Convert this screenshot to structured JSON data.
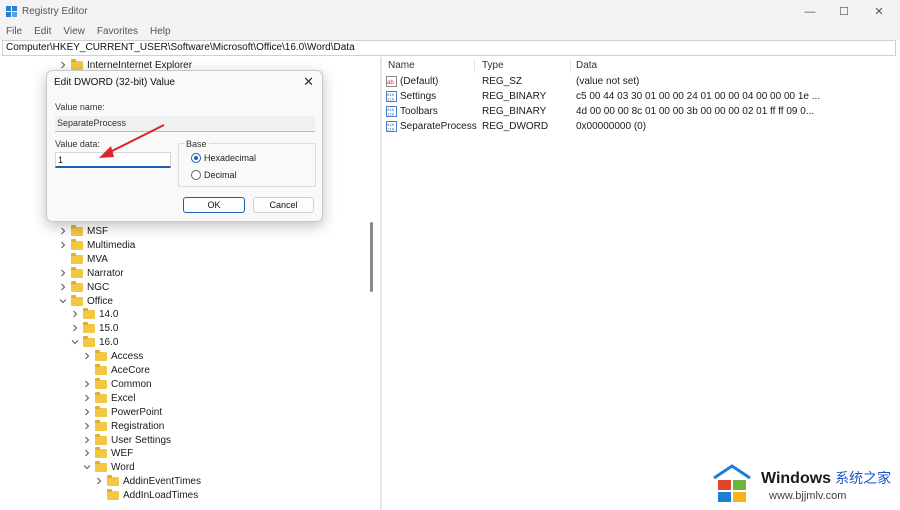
{
  "window": {
    "title": "Registry Editor",
    "controls": {
      "minimize": "—",
      "maximize": "☐",
      "close": "✕"
    }
  },
  "menu": [
    "File",
    "Edit",
    "View",
    "Favorites",
    "Help"
  ],
  "address": "Computer\\HKEY_CURRENT_USER\\Software\\Microsoft\\Office\\16.0\\Word\\Data",
  "tree": {
    "top_item": "InterneInternet Explorer",
    "items": [
      {
        "label": "MSF",
        "chevron": "right"
      },
      {
        "label": "Multimedia",
        "chevron": "right"
      },
      {
        "label": "MVA",
        "chevron": "none"
      },
      {
        "label": "Narrator",
        "chevron": "right"
      },
      {
        "label": "NGC",
        "chevron": "right"
      },
      {
        "label": "Office",
        "chevron": "down"
      },
      {
        "label": "14.0",
        "chevron": "right"
      },
      {
        "label": "15.0",
        "chevron": "right"
      },
      {
        "label": "16.0",
        "chevron": "down"
      },
      {
        "label": "Access",
        "chevron": "right"
      },
      {
        "label": "AceCore",
        "chevron": "none"
      },
      {
        "label": "Common",
        "chevron": "right"
      },
      {
        "label": "Excel",
        "chevron": "right"
      },
      {
        "label": "PowerPoint",
        "chevron": "right"
      },
      {
        "label": "Registration",
        "chevron": "right"
      },
      {
        "label": "User Settings",
        "chevron": "right"
      },
      {
        "label": "WEF",
        "chevron": "right"
      },
      {
        "label": "Word",
        "chevron": "down"
      },
      {
        "label": "AddinEventTimes",
        "chevron": "right"
      },
      {
        "label": "AddInLoadTimes",
        "chevron": "none"
      }
    ]
  },
  "list": {
    "columns": [
      "Name",
      "Type",
      "Data"
    ],
    "rows": [
      {
        "icon": "string-value-icon",
        "name": "(Default)",
        "type": "REG_SZ",
        "data": "(value not set)"
      },
      {
        "icon": "binary-value-icon",
        "name": "Settings",
        "type": "REG_BINARY",
        "data": "c5 00 44 03 30 01 00 00 24 01 00 00 04 00 00 00 1e ..."
      },
      {
        "icon": "binary-value-icon",
        "name": "Toolbars",
        "type": "REG_BINARY",
        "data": "4d 00 00 00 8c 01 00 00 3b 00 00 00 02 01 ff ff 09 0..."
      },
      {
        "icon": "binary-value-icon",
        "name": "SeparateProcess",
        "type": "REG_DWORD",
        "data": "0x00000000 (0)"
      }
    ]
  },
  "dialog": {
    "title": "Edit DWORD (32-bit) Value",
    "close": "✕",
    "value_name_label": "Value name:",
    "value_name": "SeparateProcess",
    "value_data_label": "Value data:",
    "value_data": "1",
    "base_label": "Base",
    "hex_label": "Hexadecimal",
    "dec_label": "Decimal",
    "selected_base": "Hexadecimal",
    "ok": "OK",
    "cancel": "Cancel"
  },
  "watermark": {
    "main": "Windows",
    "cn": "系统之家",
    "url": "www.bjjmlv.com"
  },
  "colors": {
    "accent": "#1a5fb4",
    "folder": "#f2c744",
    "arrow": "#d9262b"
  }
}
